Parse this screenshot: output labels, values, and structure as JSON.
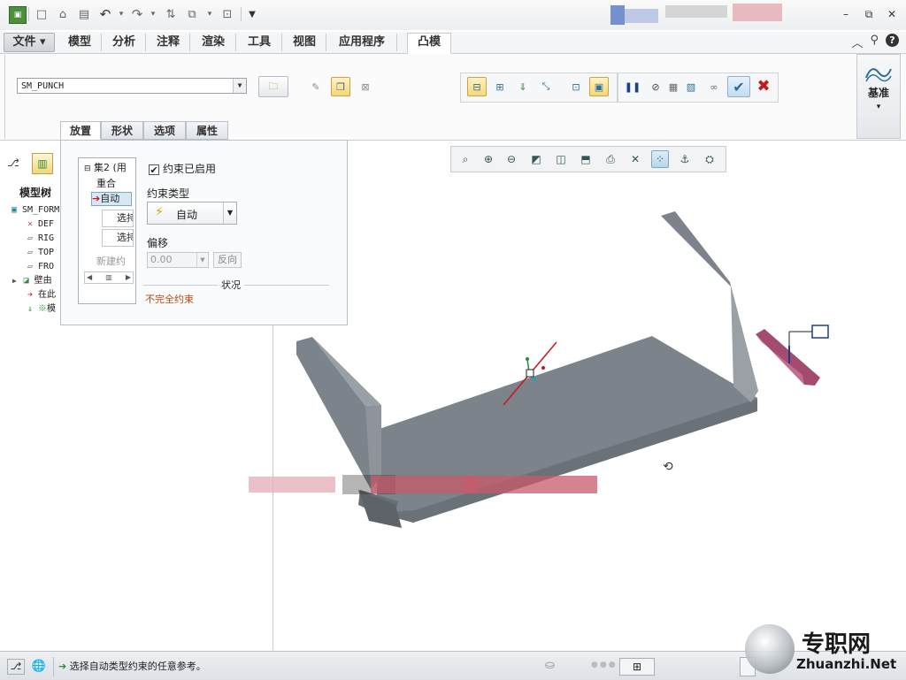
{
  "quick_access": {
    "icons": [
      "new-icon",
      "open-icon",
      "save-icon",
      "undo-icon",
      "redo-icon",
      "regenerate-icon",
      "windows-icon",
      "close-window-icon",
      "customize-icon"
    ]
  },
  "ribbon_tabs": [
    {
      "label": "文件",
      "has_menu": true
    },
    {
      "label": "模型"
    },
    {
      "label": "分析"
    },
    {
      "label": "注释"
    },
    {
      "label": "渲染"
    },
    {
      "label": "工具"
    },
    {
      "label": "视图"
    },
    {
      "label": "应用程序"
    },
    {
      "label": "凸模",
      "active": true
    }
  ],
  "dashboard": {
    "reference_model": "SM_PUNCH",
    "pause_icon": "pause-icon",
    "datum_label": "基准"
  },
  "panel": {
    "tabs": [
      "放置",
      "形状",
      "选项",
      "属性"
    ],
    "active_tab": "放置",
    "set_name": "集2 (用",
    "constraint_name": "重合",
    "constraint_item": "自动",
    "select1": "选持",
    "select2": "选持",
    "new_constraint": "新建约",
    "enabled_label": "约束已启用",
    "enabled_checked": true,
    "type_label": "约束类型",
    "type_value": "自动",
    "offset_label": "偏移",
    "offset_value": "0.00",
    "reverse_label": "反向",
    "status_label": "状况",
    "status_value": "不完全约束"
  },
  "model_tree": {
    "title": "模型树",
    "items": [
      {
        "label": "SM_FORM",
        "icon": "part-icon"
      },
      {
        "label": "DEF",
        "icon": "csys-icon"
      },
      {
        "label": "RIG",
        "icon": "plane-icon"
      },
      {
        "label": "TOP",
        "icon": "plane-icon"
      },
      {
        "label": "FRO",
        "icon": "plane-icon"
      },
      {
        "label": "壁由",
        "icon": "wall-icon"
      },
      {
        "label": "在此",
        "icon": "insert-arrow-icon"
      },
      {
        "label": "模",
        "icon": "punch-icon"
      }
    ]
  },
  "statusbar": {
    "message": "选择自动类型约束的任意参考。"
  },
  "watermark": {
    "cn": "专职网",
    "en": "Zhuanzhi.Net"
  },
  "colors": {
    "accent": "#2a6e9a",
    "status_warn": "#b84a10",
    "close_red": "#c8181e",
    "model_gray": "#7d838a",
    "punch": "#a44c70"
  }
}
